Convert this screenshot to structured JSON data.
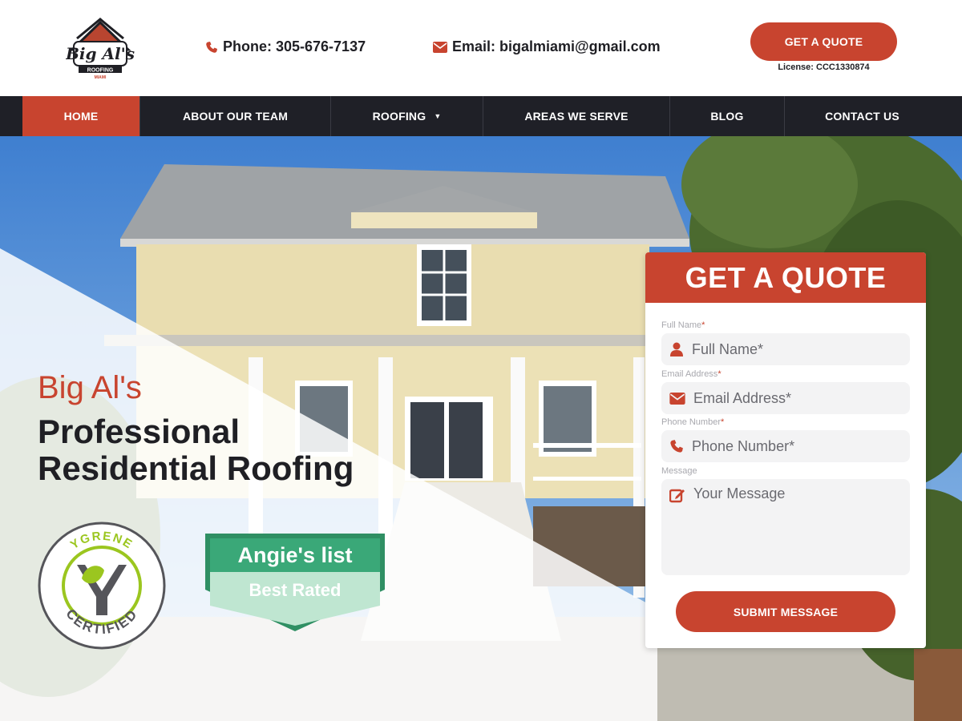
{
  "header": {
    "logo_text": "Big Al's",
    "logo_sub": "ROOFING",
    "logo_city": "MIAMI",
    "phone": "Phone: 305-676-7137",
    "email": "Email: bigalmiami@gmail.com",
    "quote_button": "GET A QUOTE",
    "license": "License: CCC1330874"
  },
  "nav": {
    "items": [
      {
        "label": "HOME",
        "active": true
      },
      {
        "label": "ABOUT OUR TEAM"
      },
      {
        "label": "ROOFING",
        "has_dropdown": true
      },
      {
        "label": "AREAS WE SERVE"
      },
      {
        "label": "BLOG"
      },
      {
        "label": "CONTACT US"
      }
    ],
    "caret": "▼"
  },
  "hero": {
    "title_small": "Big Al's",
    "title_line1": "Professional",
    "title_line2": "Residential Roofing",
    "badges": {
      "ygrene_top": "YGRENE",
      "ygrene_bottom": "CERTIFIED",
      "angies_top": "Angie's list",
      "angies_bottom": "Best Rated"
    }
  },
  "form": {
    "title": "GET A QUOTE",
    "name_label": "Full Name",
    "name_placeholder": "Full Name*",
    "email_label": "Email Address",
    "email_placeholder": "Email Address*",
    "phone_label": "Phone Number",
    "phone_placeholder": "Phone Number*",
    "message_label": "Message",
    "message_placeholder": "Your Message",
    "required_mark": "*",
    "submit": "SUBMIT MESSAGE"
  },
  "colors": {
    "accent": "#c8442f",
    "nav_bg": "#1f2027",
    "text_dark": "#1f1f24",
    "angies_green": "#3aa878"
  }
}
